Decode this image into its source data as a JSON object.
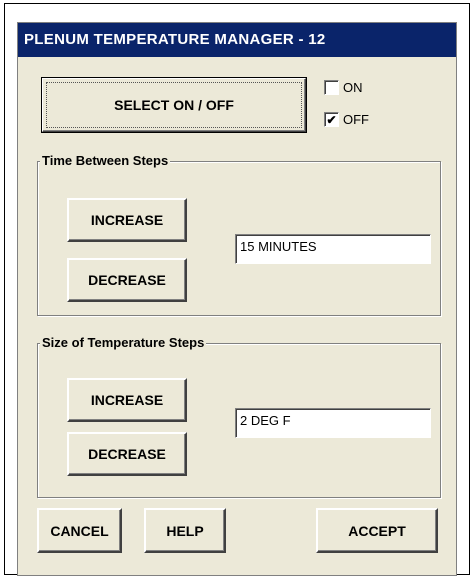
{
  "window": {
    "title": "PLENUM TEMPERATURE MANAGER - 12"
  },
  "power": {
    "select_label": "SELECT ON / OFF",
    "on_label": "ON",
    "off_label": "OFF",
    "on_checked": false,
    "off_checked": true,
    "check_mark": "✔"
  },
  "time_group": {
    "title": "Time Between Steps",
    "increase_label": "INCREASE",
    "decrease_label": "DECREASE",
    "value": "15 MINUTES"
  },
  "size_group": {
    "title": "Size of Temperature Steps",
    "increase_label": "INCREASE",
    "decrease_label": "DECREASE",
    "value": "2 DEG F"
  },
  "footer": {
    "cancel_label": "CANCEL",
    "help_label": "HELP",
    "accept_label": "ACCEPT"
  },
  "colors": {
    "title_bar": "#0a246a",
    "dialog_face": "#ece9d8"
  }
}
